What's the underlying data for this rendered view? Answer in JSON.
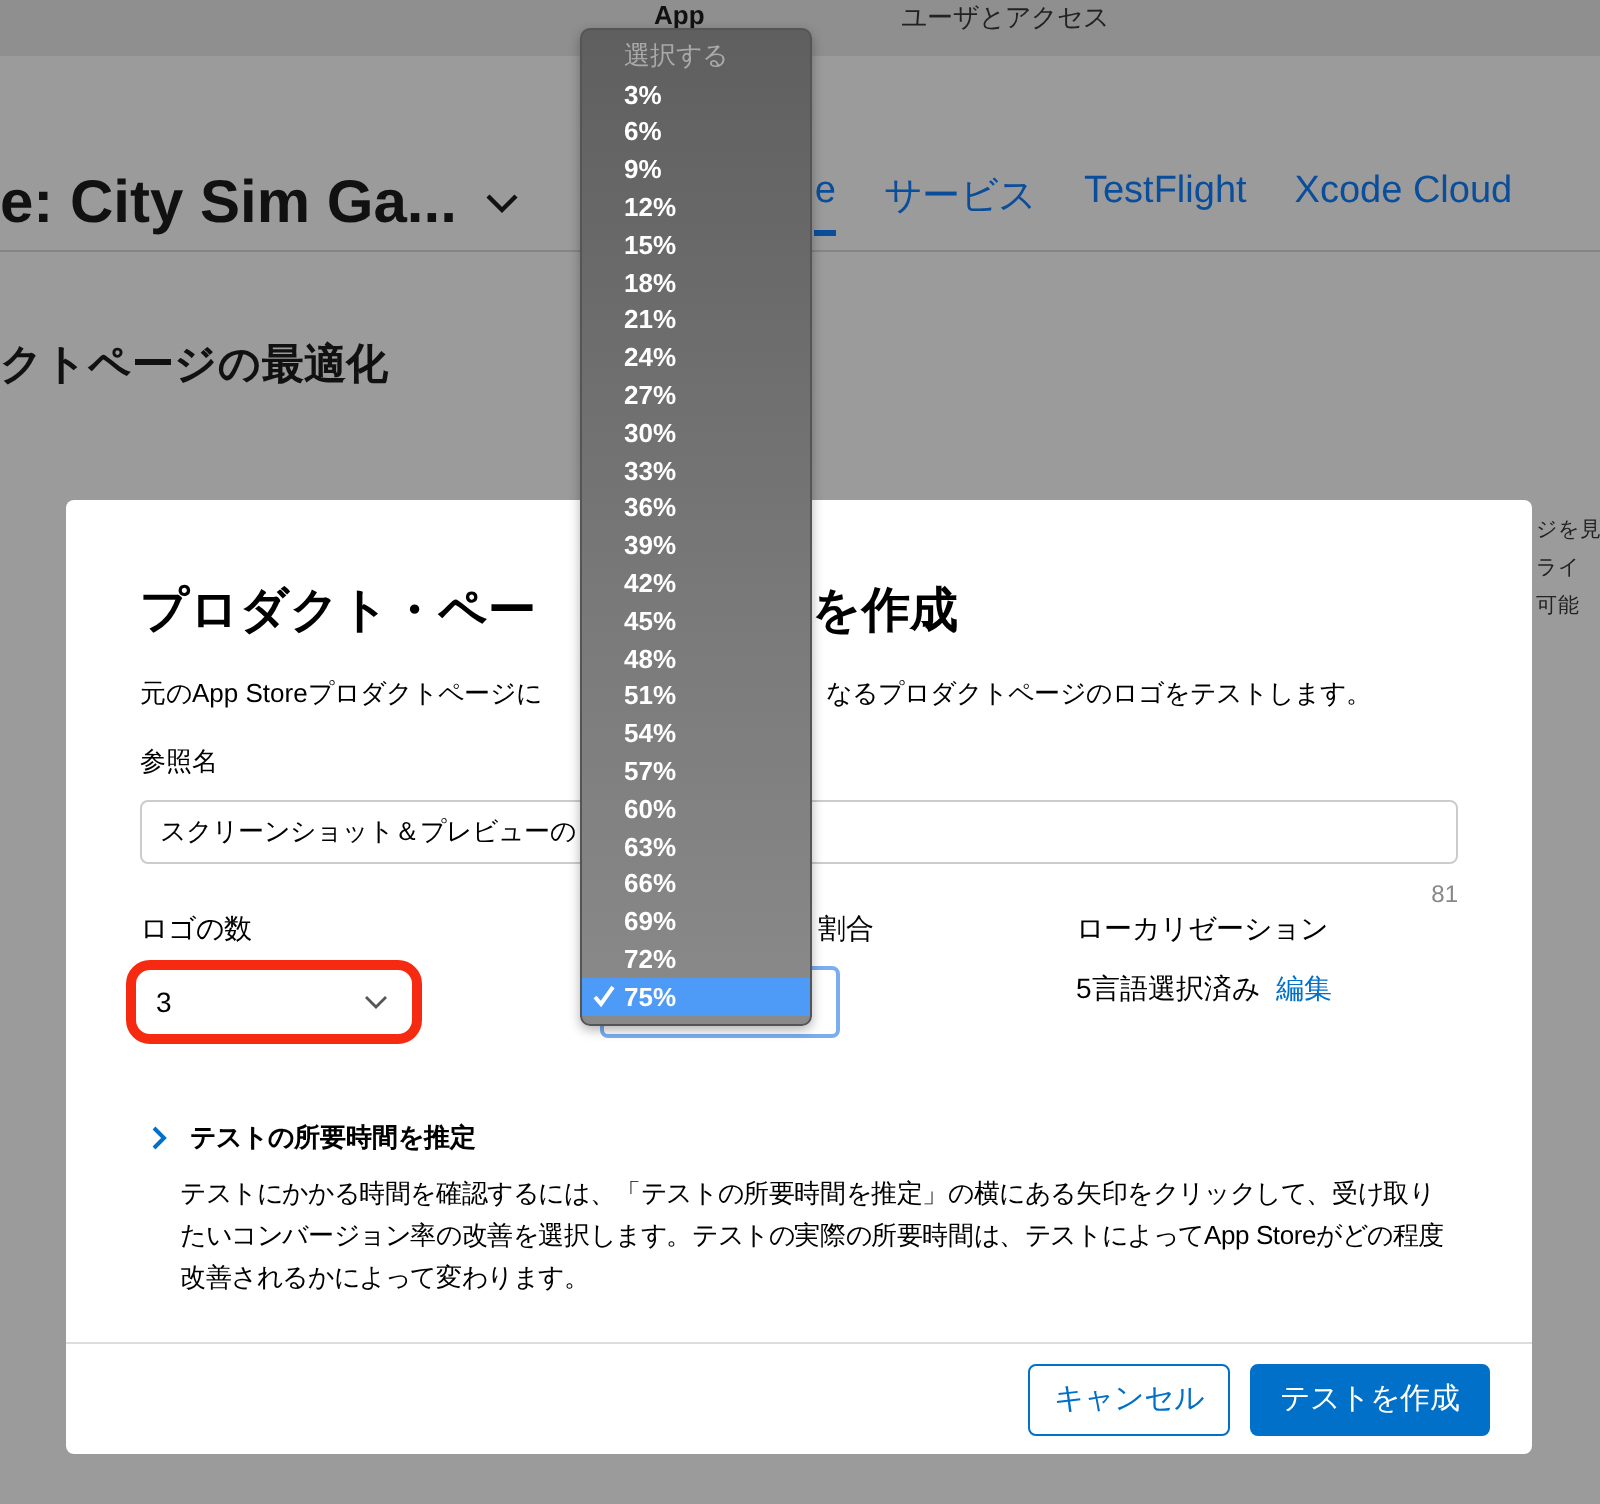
{
  "top_nav": [
    {
      "label": "App",
      "selected": true
    },
    {
      "label": "ユーザとアクセス",
      "selected": false
    }
  ],
  "app_header": {
    "title": "e: City Sim Ga...",
    "tabs": [
      {
        "label": "e",
        "selected": true
      },
      {
        "label": "サービス",
        "selected": false
      },
      {
        "label": "TestFlight",
        "selected": false
      },
      {
        "label": "Xcode Cloud",
        "selected": false
      }
    ]
  },
  "section_title": "クトページの最適化",
  "side_text": [
    "ジを見",
    "ライ",
    "可能"
  ],
  "dialog": {
    "title_left": "プロダクト・ペー",
    "title_right": "を作成",
    "description_left": "元のApp Storeプロダクトページに",
    "description_right": "なるプロダクトページのロゴをテストします。",
    "reference_name": {
      "label": "参照名",
      "value": "スクリーンショット＆プレビューの",
      "counter": "81"
    },
    "logo_count": {
      "label": "ロゴの数",
      "value": "3",
      "highlighted": true
    },
    "ratio": {
      "label": "割合",
      "focused": true
    },
    "localization": {
      "label": "ローカリゼーション",
      "value": "5言語選択済み",
      "link": "編集"
    },
    "estimate": {
      "title": "テストの所要時間を推定",
      "expanded": false,
      "text": "テストにかかる時間を確認するには、「テストの所要時間を推定」の横にある矢印をクリックして、受け取りたいコンバージョン率の改善を選択します。テストの実際の所要時間は、テストによってApp Storeがどの程度改善されるかによって変わります。"
    },
    "buttons": [
      {
        "label": "キャンセル",
        "kind": "secondary"
      },
      {
        "label": "テストを作成",
        "kind": "primary"
      }
    ]
  },
  "dropdown": [
    {
      "label": "選択する",
      "disabled": true,
      "selected": false
    },
    {
      "label": "3%",
      "disabled": false,
      "selected": false
    },
    {
      "label": "6%",
      "disabled": false,
      "selected": false
    },
    {
      "label": "9%",
      "disabled": false,
      "selected": false
    },
    {
      "label": "12%",
      "disabled": false,
      "selected": false
    },
    {
      "label": "15%",
      "disabled": false,
      "selected": false
    },
    {
      "label": "18%",
      "disabled": false,
      "selected": false
    },
    {
      "label": "21%",
      "disabled": false,
      "selected": false
    },
    {
      "label": "24%",
      "disabled": false,
      "selected": false
    },
    {
      "label": "27%",
      "disabled": false,
      "selected": false
    },
    {
      "label": "30%",
      "disabled": false,
      "selected": false
    },
    {
      "label": "33%",
      "disabled": false,
      "selected": false
    },
    {
      "label": "36%",
      "disabled": false,
      "selected": false
    },
    {
      "label": "39%",
      "disabled": false,
      "selected": false
    },
    {
      "label": "42%",
      "disabled": false,
      "selected": false
    },
    {
      "label": "45%",
      "disabled": false,
      "selected": false
    },
    {
      "label": "48%",
      "disabled": false,
      "selected": false
    },
    {
      "label": "51%",
      "disabled": false,
      "selected": false
    },
    {
      "label": "54%",
      "disabled": false,
      "selected": false
    },
    {
      "label": "57%",
      "disabled": false,
      "selected": false
    },
    {
      "label": "60%",
      "disabled": false,
      "selected": false
    },
    {
      "label": "63%",
      "disabled": false,
      "selected": false
    },
    {
      "label": "66%",
      "disabled": false,
      "selected": false
    },
    {
      "label": "69%",
      "disabled": false,
      "selected": false
    },
    {
      "label": "72%",
      "disabled": false,
      "selected": false
    },
    {
      "label": "75%",
      "disabled": false,
      "selected": true
    }
  ]
}
